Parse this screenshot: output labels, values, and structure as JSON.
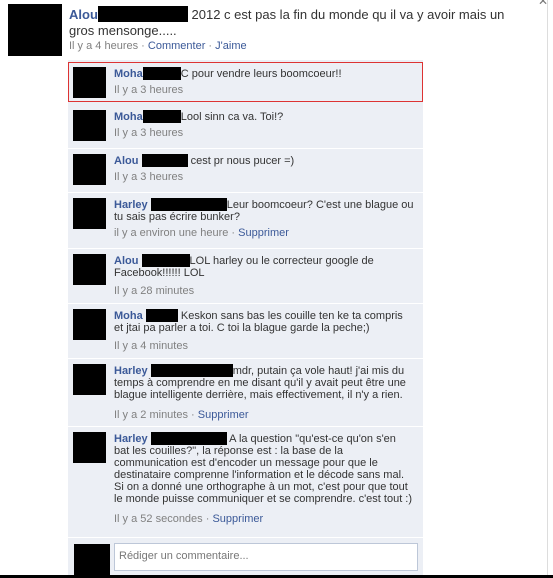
{
  "post": {
    "author": "Alou",
    "text": "2012 c est pas la fin du monde qu il va y avoir mais un gros mensonge.....",
    "time": "Il y a 4 heures",
    "comment_label": "Commenter",
    "like_label": "J'aime",
    "separator": "·"
  },
  "comments": [
    {
      "author": "Moha",
      "text": "C pour vendre leurs boomcoeur!!",
      "time": "Il y a 3 heures"
    },
    {
      "author": "Moha",
      "text": "Lool sinn ca va. Toi!?",
      "time": "Il y a 3 heures"
    },
    {
      "author": "Alou",
      "text": "cest pr nous pucer =)",
      "time": "Il y a 3 heures"
    },
    {
      "author": "Harley",
      "text": "Leur boomcoeur? C'est une blague ou tu sais pas écrire bunker?",
      "time": "il y a environ une heure",
      "action": "Supprimer"
    },
    {
      "author": "Alou",
      "text": "LOL harley ou le correcteur google de Facebook!!!!!! LOL",
      "time": "Il y a 28 minutes"
    },
    {
      "author": "Moha",
      "text": "Keskon sans bas les couille ten ke ta compris et jtai pa parler a toi. C toi la blague garde la peche;)",
      "time": "Il y a 4 minutes"
    },
    {
      "author": "Harley",
      "text": "mdr, putain ça vole haut! j'ai mis du temps à comprendre en me disant qu'il y avait peut être une blague intelligente derrière, mais effectivement, il n'y a rien.",
      "time": "Il y a 2 minutes",
      "action": "Supprimer"
    },
    {
      "author": "Harley",
      "text": "A la question \"qu'est-ce qu'on s'en bat les couilles?\", la réponse est : la base de la communication est d'encoder un message pour que le destinataire comprenne l'information et le décode sans mal. Si on a donné une orthographe à un mot, c'est pour que tout le monde puisse communiquer et se comprendre. c'est tout :)",
      "time": "Il y a 52 secondes",
      "action": "Supprimer"
    }
  ],
  "composer": {
    "placeholder": "Rédiger un commentaire..."
  }
}
